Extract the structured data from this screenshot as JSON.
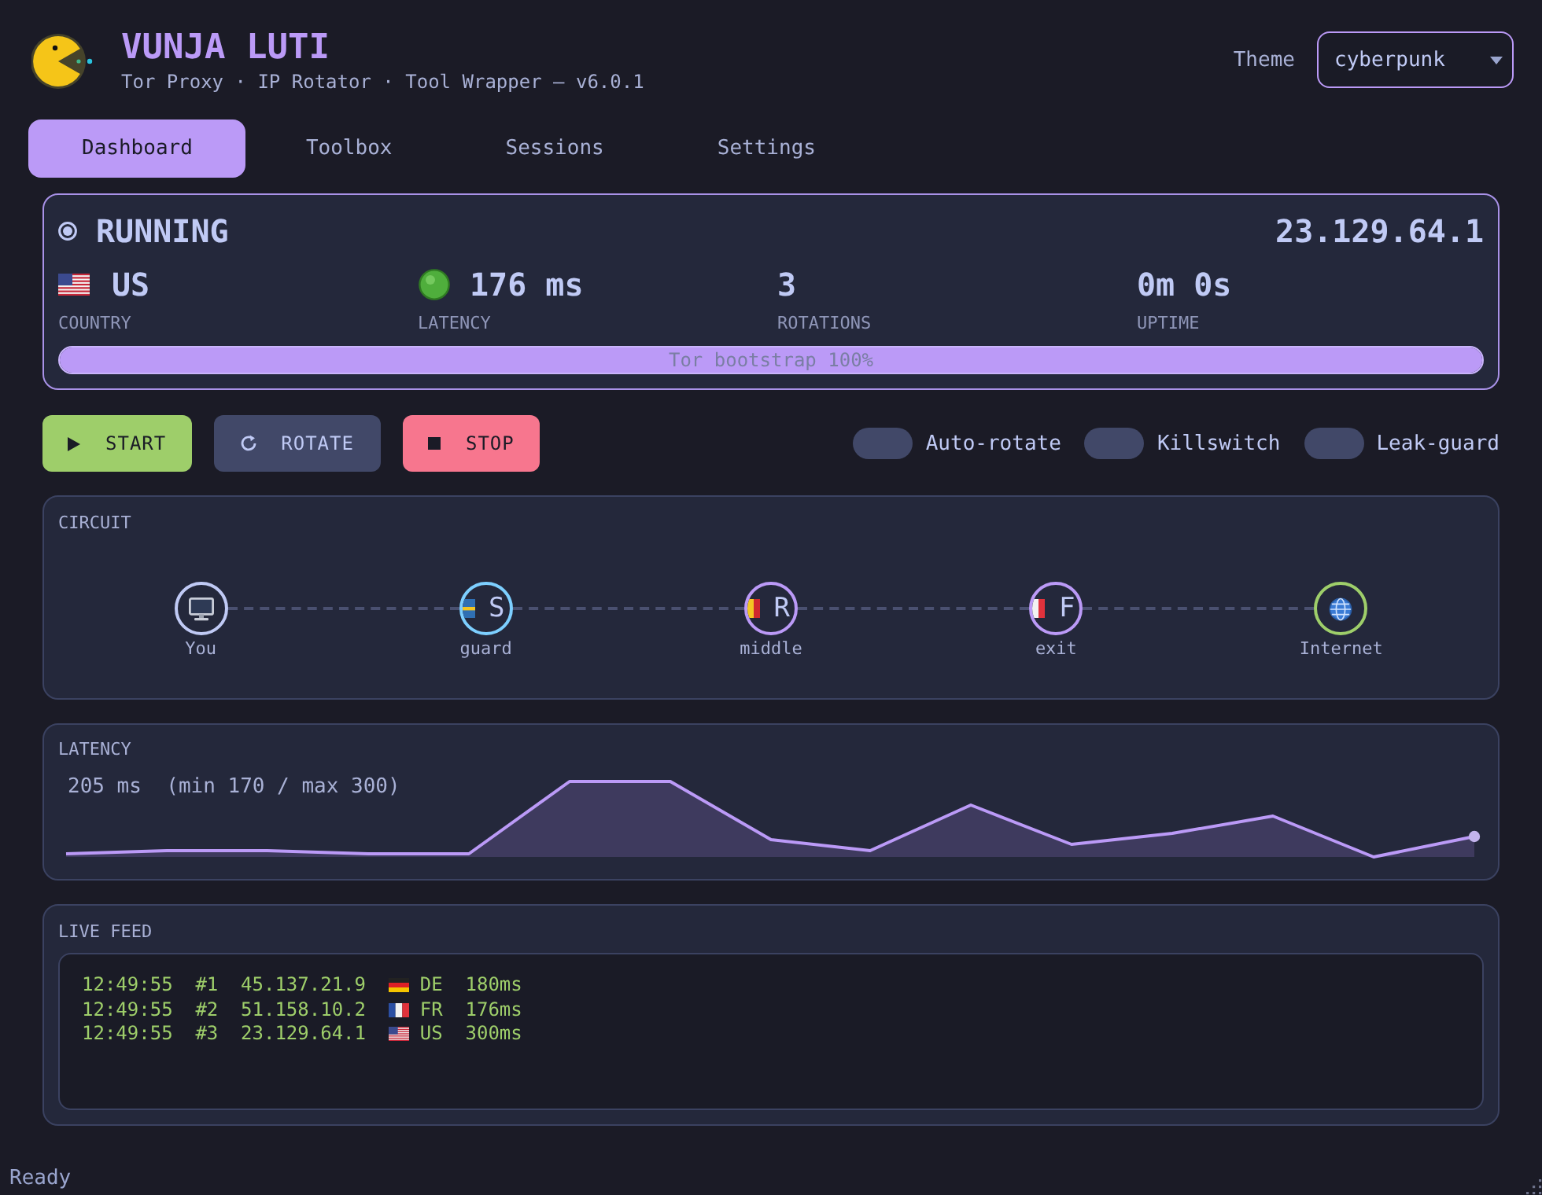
{
  "header": {
    "title": "VUNJA LUTI",
    "subtitle": "Tor Proxy · IP Rotator · Tool Wrapper — v6.0.1",
    "theme_label": "Theme",
    "theme_select": {
      "value": "cyberpunk"
    }
  },
  "tabs": [
    {
      "label": "Dashboard",
      "selected": true
    },
    {
      "label": "Toolbox",
      "selected": false
    },
    {
      "label": "Sessions",
      "selected": false
    },
    {
      "label": "Settings",
      "selected": false
    }
  ],
  "status_card": {
    "state": "RUNNING",
    "ip": "23.129.64.1",
    "stats": [
      {
        "kind": "flag",
        "flag": {
          "kind": "us"
        },
        "value": "US",
        "label": "COUNTRY"
      },
      {
        "kind": "indicator",
        "value": "176 ms",
        "label": "LATENCY"
      },
      {
        "kind": "plain",
        "value": "3",
        "label": "ROTATIONS"
      },
      {
        "kind": "plain",
        "value": "0m 0s",
        "label": "UPTIME"
      }
    ],
    "progress": {
      "label": "Tor bootstrap 100%",
      "level": 1
    }
  },
  "buttons": [
    {
      "kind": "start",
      "label": "START"
    },
    {
      "kind": "rotate",
      "label": "ROTATE"
    },
    {
      "kind": "stop",
      "label": "STOP"
    }
  ],
  "toggles": [
    {
      "label": "Auto-rotate",
      "on": false
    },
    {
      "label": "Killswitch",
      "on": false
    },
    {
      "label": "Leak-guard",
      "on": false
    }
  ],
  "circuit": {
    "title": "CIRCUIT",
    "nodes": [
      {
        "kind": "client",
        "label": "You",
        "color": "#c0caf5"
      },
      {
        "kind": "relay",
        "label": "guard",
        "flag": {
          "kind": "se"
        },
        "letter": "S",
        "color": "#7dcfff"
      },
      {
        "kind": "relay",
        "label": "middle",
        "flag": {
          "kind": "ro"
        },
        "letter": "R",
        "color": "#bb9af7"
      },
      {
        "kind": "relay",
        "label": "exit",
        "flag": {
          "kind": "fr"
        },
        "letter": "F",
        "color": "#bb9af7"
      },
      {
        "kind": "internet",
        "label": "Internet",
        "color": "#9ece6a"
      }
    ]
  },
  "latency": {
    "title": "LATENCY",
    "summary": "205 ms  (min 170 / max 300)"
  },
  "live_feed": {
    "title": "LIVE FEED",
    "rows": [
      {
        "time": "12:49:55",
        "index": "#1",
        "ip": "45.137.21.9",
        "flag": {
          "kind": "de"
        },
        "country": "DE",
        "latency": "180ms"
      },
      {
        "time": "12:49:55",
        "index": "#2",
        "ip": "51.158.10.2",
        "flag": {
          "kind": "fr"
        },
        "country": "FR",
        "latency": "176ms"
      },
      {
        "time": "12:49:55",
        "index": "#3",
        "ip": "23.129.64.1",
        "flag": {
          "kind": "us"
        },
        "country": "US",
        "latency": "300ms"
      }
    ]
  },
  "status_bar": {
    "text": "Ready"
  }
}
